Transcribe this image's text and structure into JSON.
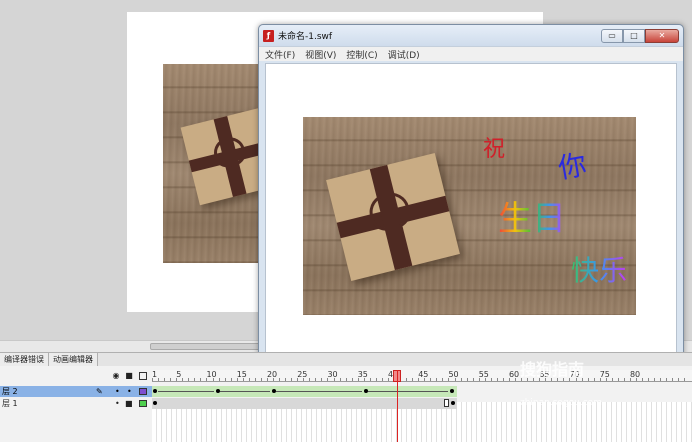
{
  "player": {
    "title": "未命名-1.swf",
    "app_icon": "flash-player-icon",
    "buttons": {
      "minimize": "▭",
      "restore": "□",
      "close": "✕"
    },
    "menu": [
      "文件(F)",
      "视图(V)",
      "控制(C)",
      "调试(D)"
    ]
  },
  "movie": {
    "greeting": [
      "祝",
      "你",
      "生日",
      "快乐"
    ],
    "greeting_colors": [
      "#d0202a",
      "#2a2ae0",
      "#e83a8a",
      "#44aa44"
    ]
  },
  "panel": {
    "tabs": [
      "编译器错误",
      "动画编辑器"
    ]
  },
  "timeline": {
    "ruler_labels": [
      "1",
      "5",
      "10",
      "15",
      "20",
      "25",
      "30",
      "35",
      "40",
      "45",
      "50",
      "55",
      "60",
      "65",
      "70",
      "75",
      "80"
    ],
    "playhead_frame": "",
    "layers": [
      {
        "name": "层 2",
        "selected": true
      },
      {
        "name": "层 1",
        "selected": false
      }
    ],
    "header_icons": [
      "eye-icon",
      "lock-icon",
      "outline-icon"
    ]
  },
  "watermark": {
    "text": "搜狗指南",
    "sub": "zhinan.sogou.com"
  }
}
